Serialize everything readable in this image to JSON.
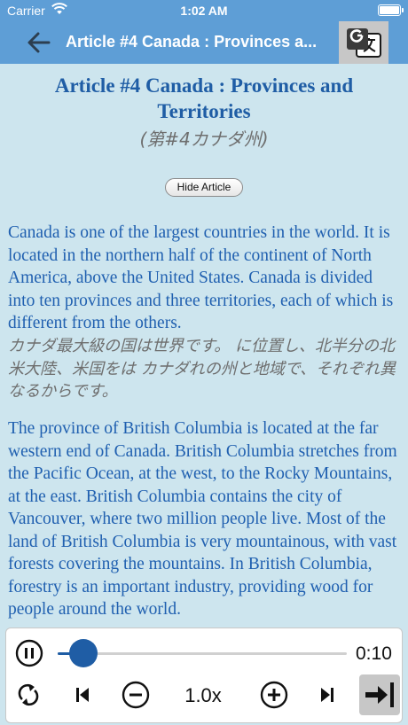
{
  "status_bar": {
    "carrier": "Carrier",
    "time": "1:02 AM"
  },
  "nav": {
    "title": "Article #4 Canada : Provinces a..."
  },
  "article": {
    "title": "Article #4 Canada : Provinces and Territories",
    "title_jp": "(第#4カナダ州)",
    "hide_button_label": "Hide Article",
    "paragraphs": [
      {
        "en": "Canada is one of the largest countries in the world. It is located in the northern half of the continent of North America, above the United States. Canada is divided into ten provinces and three territories, each of which is different from the others.",
        "jp": "カナダ最大級の国は世界です。 に位置し、北半分の北米大陸、米国をは カナダれの州と地域で、それぞれ異なるからです。"
      },
      {
        "en": "The province of British Columbia is located at the far western end of Canada. British Columbia stretches from the Pacific Ocean, at the west, to the Rocky Mountains, at the east. British Columbia contains the city of Vancouver, where two million people live. Most of the land of British Columbia is very mountainous, with vast forests covering the mountains. In British Columbia, forestry is an important industry, providing wood for people around the world."
      }
    ]
  },
  "player": {
    "elapsed": "0:10",
    "progress": 0.09,
    "speed": "1.0x"
  },
  "icons": {
    "back": "back-arrow-icon",
    "translate": "google-translate-icon",
    "pause": "pause-icon",
    "repeat": "repeat-icon",
    "previous": "skip-previous-icon",
    "slower": "minus-circle-icon",
    "faster": "plus-circle-icon",
    "next": "skip-next-icon",
    "exit": "exit-arrow-icon"
  },
  "colors": {
    "nav_background": "#5e9ed6",
    "page_background": "#cde5ee",
    "title_text": "#1f5da5",
    "english_text": "#2060b0",
    "japanese_text": "#6e6e6e",
    "accent": "#1f5da5"
  }
}
